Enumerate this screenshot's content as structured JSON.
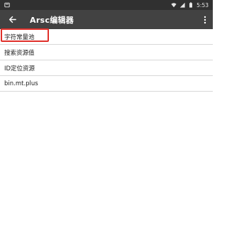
{
  "status_bar": {
    "time": "5:53",
    "icons": [
      "notification-icon",
      "wifi-icon",
      "signal-icon",
      "battery-icon"
    ]
  },
  "app_bar": {
    "title": "Arsc编辑器",
    "back_icon": "back-arrow-icon",
    "menu_icon": "more-vert-icon"
  },
  "list": {
    "items": [
      {
        "label": "字符常量池"
      },
      {
        "label": "搜索资源值"
      },
      {
        "label": "ID定位资源"
      },
      {
        "label": "bin.mt.plus"
      }
    ]
  },
  "colors": {
    "status_bar_bg": "#303030",
    "app_bar_bg": "#424242",
    "highlight": "#e0302a",
    "divider": "#d8d8d8"
  }
}
